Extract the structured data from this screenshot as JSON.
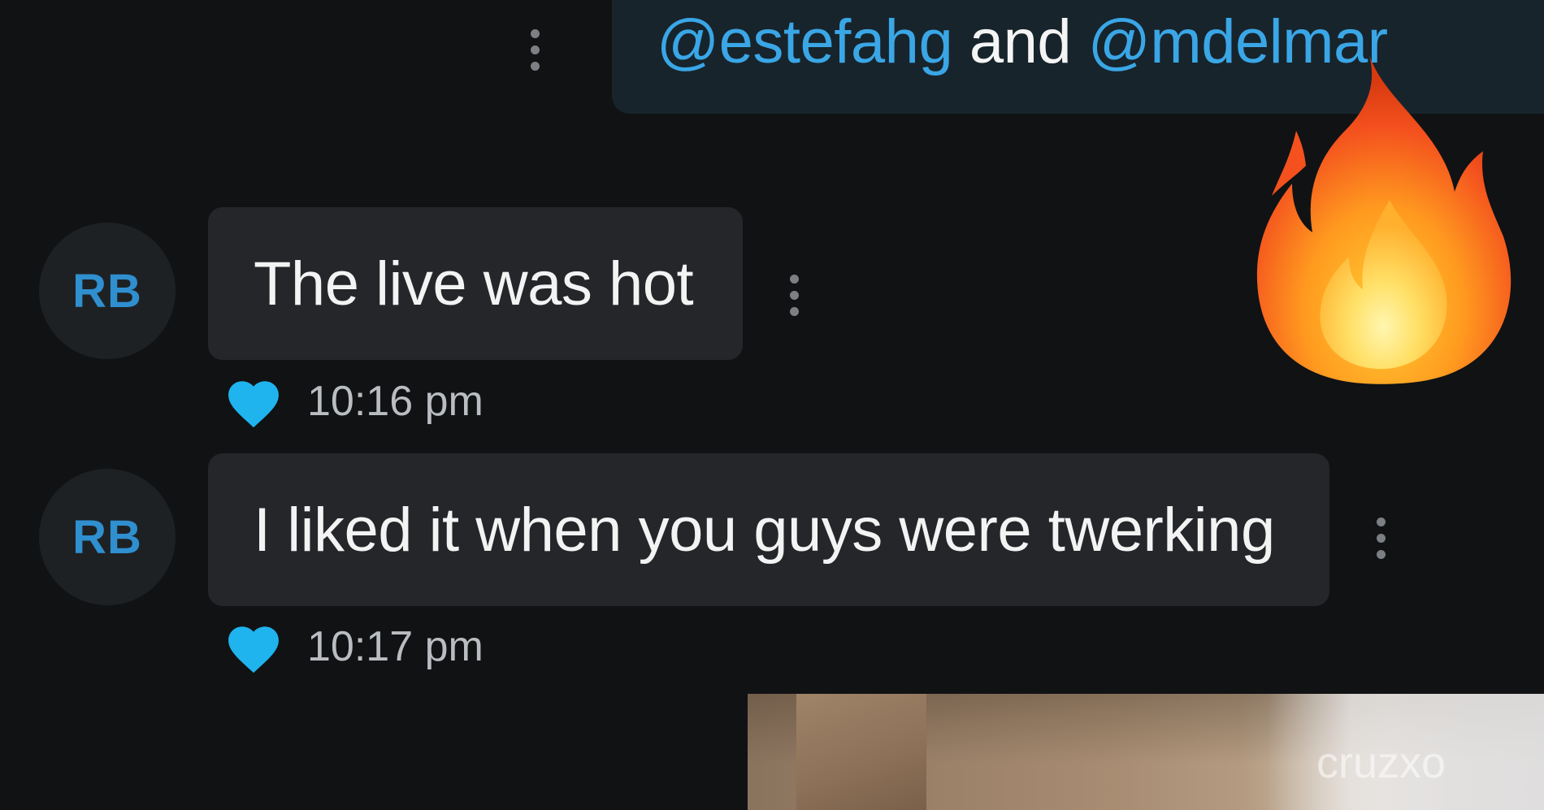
{
  "top_message": {
    "mention_1": "@estefahg",
    "connector": "and",
    "mention_2": "@mdelmar"
  },
  "messages": [
    {
      "avatar_initials": "RB",
      "text": "The live was hot",
      "time": "10:16 pm",
      "reaction_icon": "heart-icon"
    },
    {
      "avatar_initials": "RB",
      "text": "I liked it when you guys were twerking",
      "time": "10:17 pm",
      "reaction_icon": "heart-icon"
    }
  ],
  "overlay_emoji": "fire-emoji",
  "watermark": "cruzxo",
  "colors": {
    "background": "#111214",
    "incoming_bubble": "#24262a",
    "outgoing_bubble": "#17242c",
    "mention": "#3aa6e6",
    "avatar_text": "#2f8fcf",
    "heart": "#1fb4ee"
  }
}
